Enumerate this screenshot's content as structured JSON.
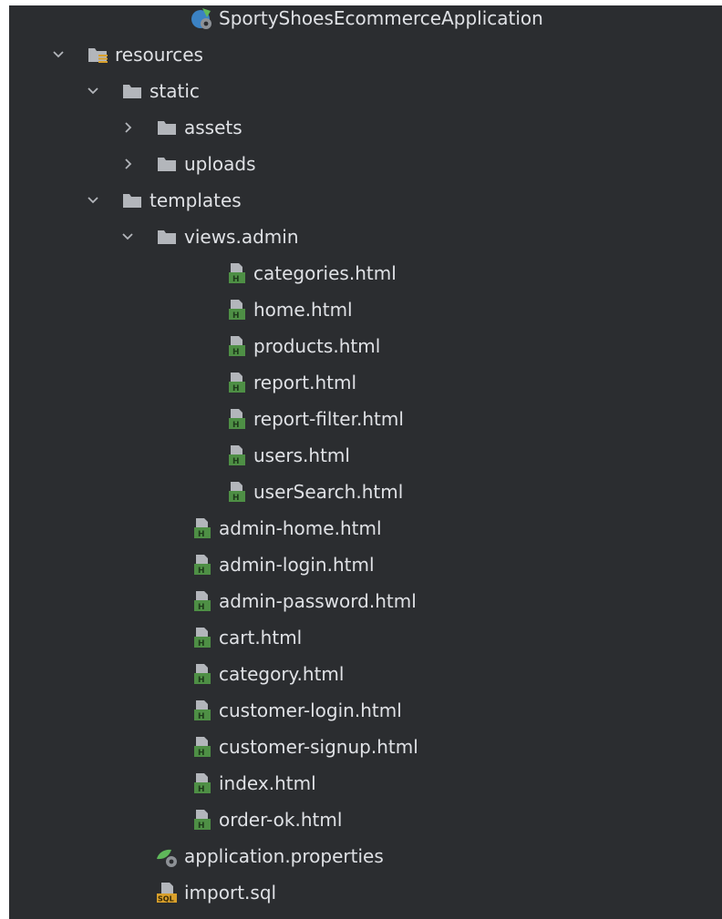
{
  "tree": [
    {
      "label": "SportyShoesEcommerceApplication",
      "kind": "spring-app",
      "depth": 5,
      "chevron": "none"
    },
    {
      "label": "resources",
      "kind": "resources-folder",
      "depth": 2,
      "chevron": "expanded"
    },
    {
      "label": "static",
      "kind": "folder",
      "depth": 3,
      "chevron": "expanded"
    },
    {
      "label": "assets",
      "kind": "folder",
      "depth": 4,
      "chevron": "collapsed"
    },
    {
      "label": "uploads",
      "kind": "folder",
      "depth": 4,
      "chevron": "collapsed"
    },
    {
      "label": "templates",
      "kind": "folder",
      "depth": 3,
      "chevron": "expanded"
    },
    {
      "label": "views.admin",
      "kind": "folder",
      "depth": 4,
      "chevron": "expanded"
    },
    {
      "label": "categories.html",
      "kind": "html-file",
      "depth": 6,
      "chevron": "none"
    },
    {
      "label": "home.html",
      "kind": "html-file",
      "depth": 6,
      "chevron": "none"
    },
    {
      "label": "products.html",
      "kind": "html-file",
      "depth": 6,
      "chevron": "none"
    },
    {
      "label": "report.html",
      "kind": "html-file",
      "depth": 6,
      "chevron": "none"
    },
    {
      "label": "report-filter.html",
      "kind": "html-file",
      "depth": 6,
      "chevron": "none"
    },
    {
      "label": "users.html",
      "kind": "html-file",
      "depth": 6,
      "chevron": "none"
    },
    {
      "label": "userSearch.html",
      "kind": "html-file",
      "depth": 6,
      "chevron": "none"
    },
    {
      "label": "admin-home.html",
      "kind": "html-file",
      "depth": 5,
      "chevron": "none"
    },
    {
      "label": "admin-login.html",
      "kind": "html-file",
      "depth": 5,
      "chevron": "none"
    },
    {
      "label": "admin-password.html",
      "kind": "html-file",
      "depth": 5,
      "chevron": "none"
    },
    {
      "label": "cart.html",
      "kind": "html-file",
      "depth": 5,
      "chevron": "none"
    },
    {
      "label": "category.html",
      "kind": "html-file",
      "depth": 5,
      "chevron": "none"
    },
    {
      "label": "customer-login.html",
      "kind": "html-file",
      "depth": 5,
      "chevron": "none"
    },
    {
      "label": "customer-signup.html",
      "kind": "html-file",
      "depth": 5,
      "chevron": "none"
    },
    {
      "label": "index.html",
      "kind": "html-file",
      "depth": 5,
      "chevron": "none"
    },
    {
      "label": "order-ok.html",
      "kind": "html-file",
      "depth": 5,
      "chevron": "none"
    },
    {
      "label": "application.properties",
      "kind": "properties-file",
      "depth": 4,
      "chevron": "none"
    },
    {
      "label": "import.sql",
      "kind": "sql-file",
      "depth": 4,
      "chevron": "none"
    }
  ],
  "colors": {
    "background": "#2b2d30",
    "text": "#dfe1e5",
    "folder": "#b3b6bb",
    "chevron": "#b3b6bb",
    "html_green": "#4e8f45",
    "spring_green": "#5fb85a",
    "sql_orange": "#d9a02b"
  }
}
